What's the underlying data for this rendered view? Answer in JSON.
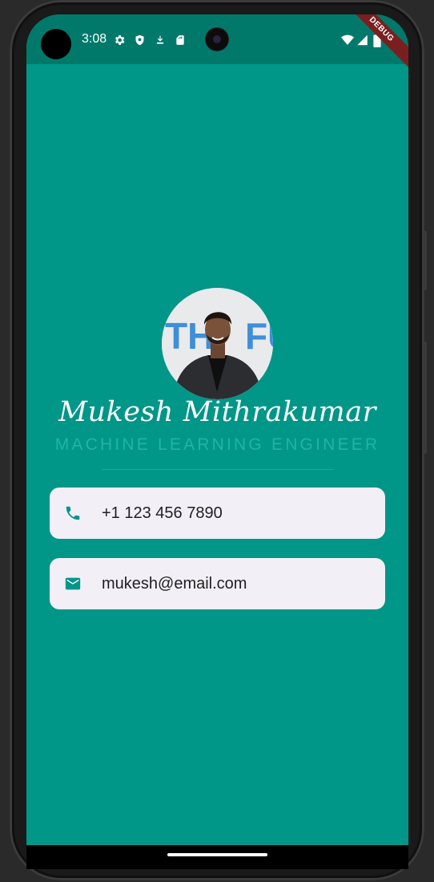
{
  "status_bar": {
    "time": "3:08",
    "left_icons": [
      "settings-icon",
      "shield-icon",
      "download-icon",
      "sd-card-icon"
    ],
    "right_icons": [
      "wifi-icon",
      "signal-icon",
      "battery-icon"
    ],
    "debug_banner": "DEBUG"
  },
  "profile": {
    "name": "Mukesh Mithrakumar",
    "title": "MACHINE LEARNING ENGINEER"
  },
  "contacts": [
    {
      "icon": "phone-icon",
      "text": "+1 123 456 7890"
    },
    {
      "icon": "email-icon",
      "text": "mukesh@email.com"
    }
  ],
  "colors": {
    "background": "#009688",
    "status_bar": "#00796b",
    "card": "#f3eff7",
    "accent": "#26a69a",
    "subtitle": "#1fb5a6"
  }
}
